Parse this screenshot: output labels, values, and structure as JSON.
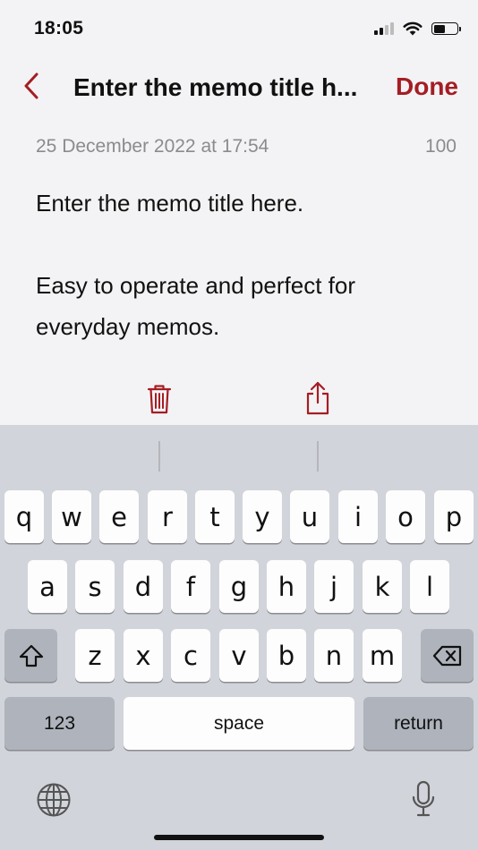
{
  "status_bar": {
    "time": "18:05",
    "signal_icon": "cellular-signal-icon",
    "wifi_icon": "wifi-icon",
    "battery_icon": "battery-icon",
    "battery_level": 0.5
  },
  "nav": {
    "back_icon": "chevron-left-icon",
    "title": "Enter the memo title h...",
    "done_label": "Done",
    "accent_color": "#a51d24"
  },
  "memo": {
    "date": "25 December 2022 at 17:54",
    "char_count": "100",
    "lines": [
      "Enter the memo title here.",
      "",
      "Easy to operate and perfect for",
      "everyday memos."
    ]
  },
  "toolbar": {
    "delete_icon": "trash-icon",
    "share_icon": "share-icon"
  },
  "keyboard": {
    "row1": [
      "q",
      "w",
      "e",
      "r",
      "t",
      "y",
      "u",
      "i",
      "o",
      "p"
    ],
    "row2": [
      "a",
      "s",
      "d",
      "f",
      "g",
      "h",
      "j",
      "k",
      "l"
    ],
    "row3": [
      "z",
      "x",
      "c",
      "v",
      "b",
      "n",
      "m"
    ],
    "shift_icon": "shift-icon",
    "delete_icon": "backspace-icon",
    "numbers_label": "123",
    "space_label": "space",
    "return_label": "return",
    "globe_icon": "globe-icon",
    "mic_icon": "microphone-icon"
  }
}
